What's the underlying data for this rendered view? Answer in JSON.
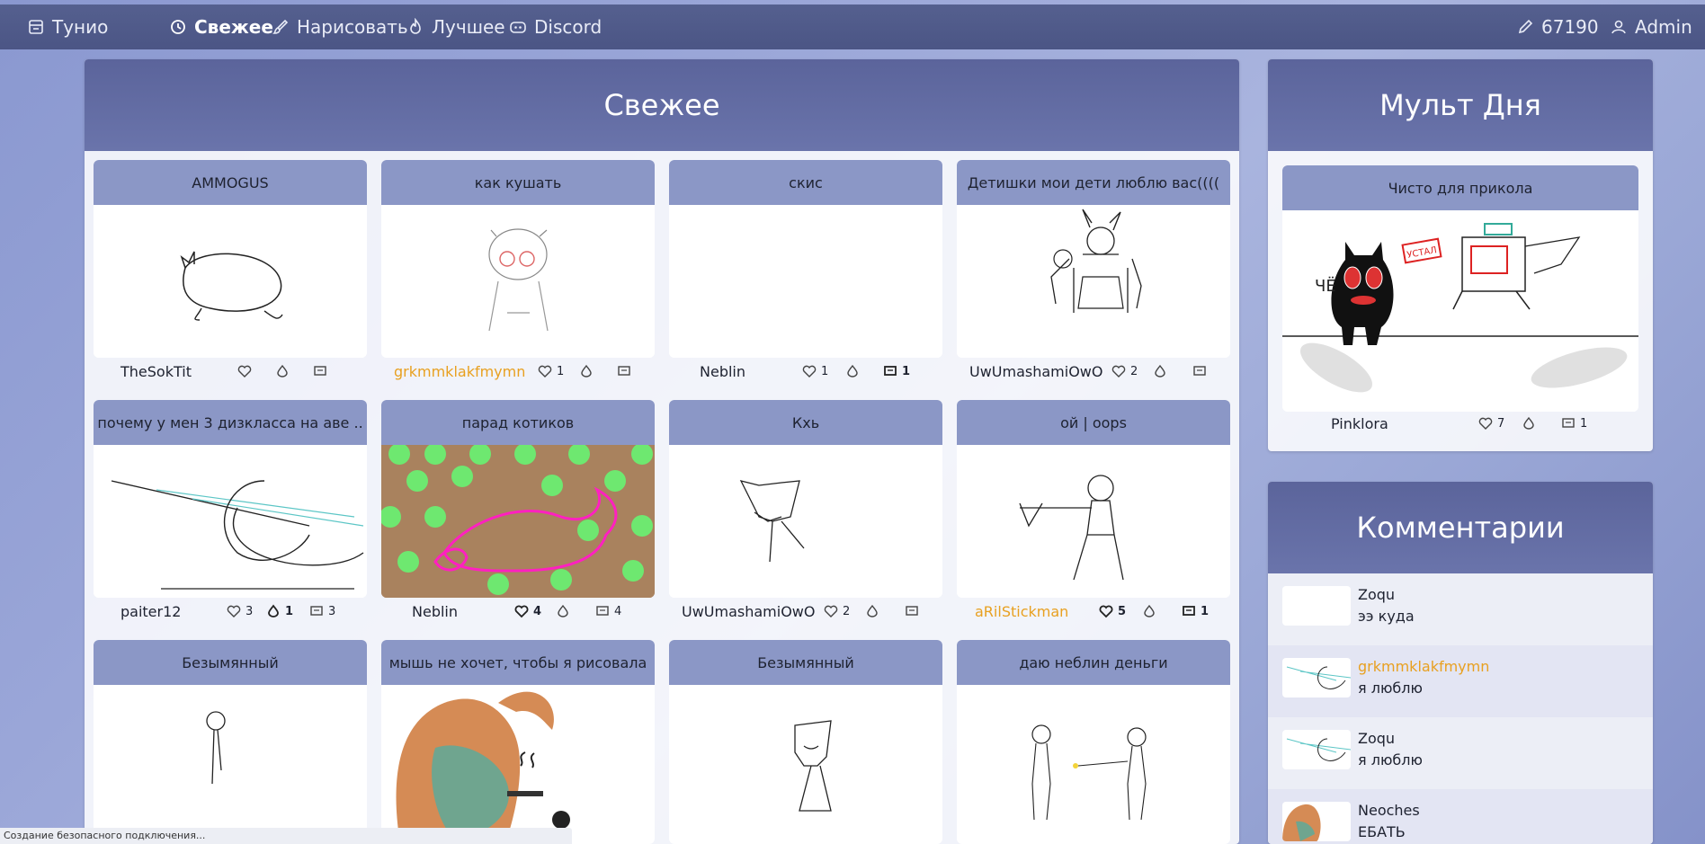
{
  "nav": {
    "brand": "Тунио",
    "fresh": "Свежее",
    "draw": "Нарисовать",
    "best": "Лучшее",
    "discord": "Discord",
    "ink_count": "67190",
    "user": "Admin"
  },
  "main": {
    "title": "Свежее",
    "cards": [
      {
        "title": "AMMOGUS",
        "author": "TheSokTit",
        "likes": "",
        "boosts": "",
        "comments": ""
      },
      {
        "title": "как кушать",
        "author": "grkmmklakfmymn",
        "likes": "1",
        "boosts": "",
        "comments": ""
      },
      {
        "title": "скис",
        "author": "Neblin",
        "likes": "1",
        "boosts": "",
        "comments": "1"
      },
      {
        "title": "Детишки мои дети люблю вас((((",
        "author": "UwUmashamiOwO",
        "likes": "2",
        "boosts": "",
        "comments": ""
      },
      {
        "title": "почему у мен 3 дизкласса на аве ..",
        "author": "paiter12",
        "likes": "3",
        "boosts": "1",
        "comments": "3"
      },
      {
        "title": "парад котиков",
        "author": "Neblin",
        "likes": "4",
        "boosts": "",
        "comments": "4"
      },
      {
        "title": "Кхь",
        "author": "UwUmashamiOwO",
        "likes": "2",
        "boosts": "",
        "comments": ""
      },
      {
        "title": "ой | oops",
        "author": "aRilStickman",
        "likes": "5",
        "boosts": "",
        "comments": "1"
      },
      {
        "title": "Безымянный",
        "author": "",
        "likes": "",
        "boosts": "",
        "comments": ""
      },
      {
        "title": "мышь не хочет, чтобы я рисовала",
        "author": "",
        "likes": "",
        "boosts": "",
        "comments": ""
      },
      {
        "title": "Безымянный",
        "author": "",
        "likes": "",
        "boosts": "",
        "comments": ""
      },
      {
        "title": "даю неблин деньги",
        "author": "",
        "likes": "",
        "boosts": "",
        "comments": ""
      }
    ]
  },
  "cartoon_of_day": {
    "title": "Мульт Дня",
    "card_title": "Чисто для прикола",
    "author": "Pinklora",
    "likes": "7",
    "comments": "1",
    "drawing_text": "УСТАЛ",
    "drawing_text2": "ЧЁ"
  },
  "comments": {
    "title": "Комментарии",
    "items": [
      {
        "user": "Zoqu",
        "text": "ээ куда"
      },
      {
        "user": "grkmmklakfmymn",
        "text": "я люблю"
      },
      {
        "user": "Zoqu",
        "text": "я люблю"
      },
      {
        "user": "Neoches",
        "text": "ЕБАТЬ"
      }
    ]
  },
  "status": "Создание безопасного подключения..."
}
